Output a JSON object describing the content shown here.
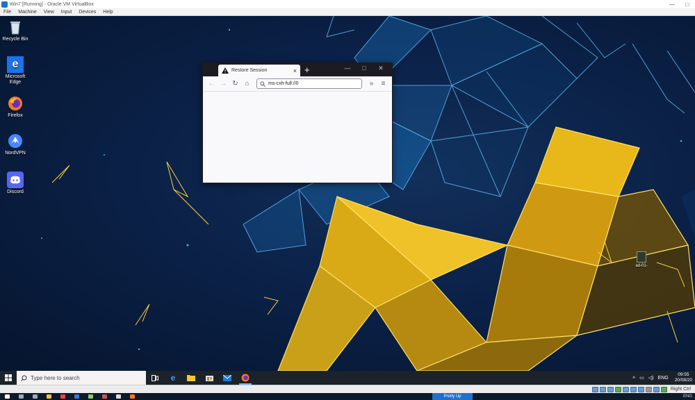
{
  "vbox": {
    "title": "Win7 [Running] - Oracle VM VirtualBox",
    "menu": [
      "File",
      "Machine",
      "View",
      "Input",
      "Devices",
      "Help"
    ],
    "host_key": "Right Ctrl"
  },
  "desktop_icons": [
    {
      "label": "Recycle Bin",
      "icon": "recycle-bin-icon"
    },
    {
      "label": "Microsoft Edge",
      "icon": "edge-icon"
    },
    {
      "label": "Firefox",
      "icon": "firefox-icon"
    },
    {
      "label": "NordVPN",
      "icon": "nordvpn-icon"
    },
    {
      "label": "Discord",
      "icon": "discord-icon"
    }
  ],
  "desktop_file": {
    "label": "ad-01-",
    "icon": "file-icon"
  },
  "firefox": {
    "tab_title": "Restore Session",
    "url": "ms-cxh-full://0",
    "new_tab": "+",
    "close_tab": "×",
    "menu_glyph": "≡",
    "overflow_glyph": "»"
  },
  "taskbar": {
    "search_placeholder": "Type here to search",
    "pinned": [
      "task-view-icon",
      "edge-icon",
      "file-explorer-icon",
      "store-icon",
      "mail-icon",
      "firefox-icon"
    ],
    "language": "ENG",
    "time": "09:55",
    "date": "20/08/20"
  },
  "host_taskbar": {
    "popup_label": "Pretty Up"
  },
  "colors": {
    "accent_blue": "#1f6fd1",
    "ff_chrome": "#1c1b22",
    "taskbar": "#1b2229",
    "wallpaper_gold": "#f2c21b",
    "wallpaper_blue": "#1e88e5"
  }
}
